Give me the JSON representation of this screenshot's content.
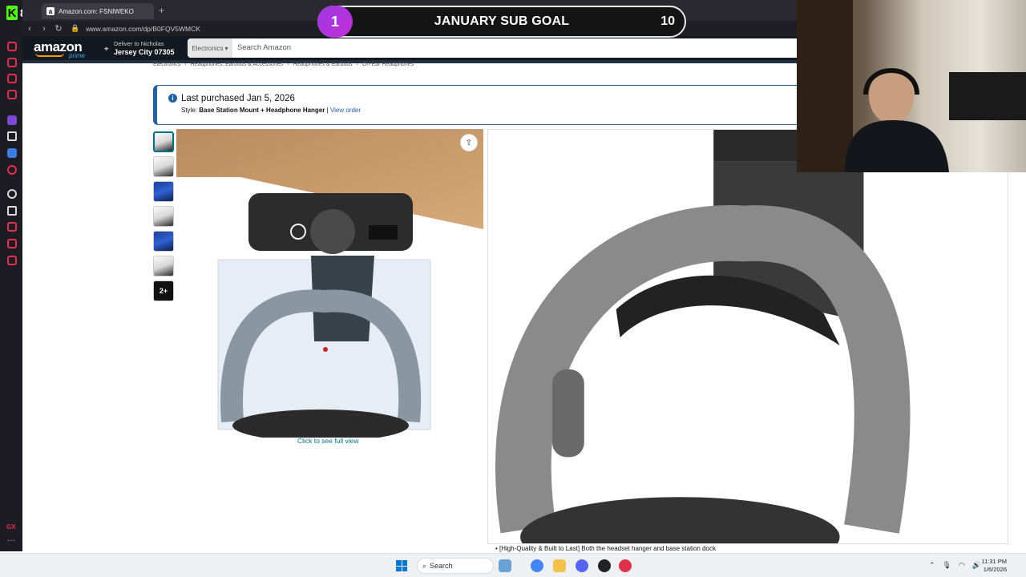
{
  "browser": {
    "tab_title": "Amazon.com: FSNIWEKO",
    "url": "www.amazon.com/dp/B0FQV5WMCK",
    "rail_count": "8",
    "rail_gx": "GX"
  },
  "overlay": {
    "level": "1",
    "title": "JANUARY SUB GOAL",
    "goal": "10"
  },
  "amazon": {
    "logo": "amazon",
    "prime": "prime",
    "deliver_line1": "Deliver to Nicholas",
    "deliver_line2": "Jersey City 07305",
    "search_category": "Electronics",
    "search_placeholder": "Search Amazon"
  },
  "breadcrumb": [
    "Electronics",
    "›",
    "Headphones, Earbuds & Accessories",
    "›",
    "Headphones & Earbuds",
    "›",
    "On-Ear Headphones"
  ],
  "purchase": {
    "title": "Last purchased Jan 5, 2026",
    "style_label": "Style:",
    "style_value": "Base Station Mount + Headphone Hanger",
    "separator": "|",
    "view_order": "View order"
  },
  "thumbnails": {
    "more_label": "2+"
  },
  "gallery": {
    "see_full": "Click to see full view"
  },
  "bullet": "[High-Quality & Built to Last] Both the headset hanger and base station dock",
  "taskbar": {
    "search_label": "Search",
    "time": "11:31 PM",
    "date": "1/6/2026"
  },
  "colors": {
    "kick_green": "#53fc18",
    "amazon_dark": "#131921",
    "amazon_orange": "#febd69",
    "link_blue": "#2162a1",
    "overlay_purple": "#9d38e0"
  }
}
